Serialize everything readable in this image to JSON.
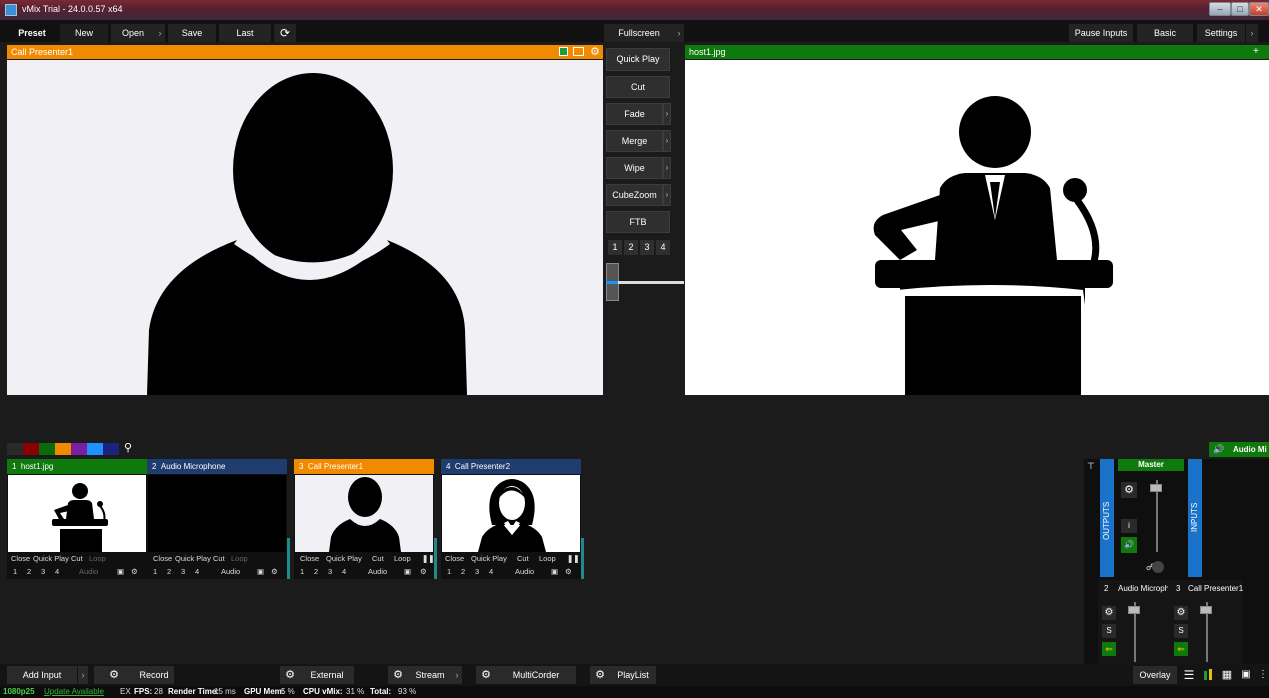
{
  "window": {
    "title": "vMix Trial - 24.0.0.57 x64"
  },
  "toolbar": {
    "preset": "Preset",
    "new": "New",
    "open": "Open",
    "save": "Save",
    "last": "Last",
    "fullscreen": "Fullscreen",
    "pause_inputs": "Pause Inputs",
    "basic": "Basic",
    "settings": "Settings"
  },
  "preview": {
    "title": "Call Presenter1",
    "accent": "#f28a00"
  },
  "output": {
    "title": "host1.jpg",
    "accent": "#0e7a0e"
  },
  "transitions": {
    "quick_play": "Quick Play",
    "cut": "Cut",
    "fade": "Fade",
    "merge": "Merge",
    "wipe": "Wipe",
    "cubezoom": "CubeZoom",
    "ftb": "FTB",
    "numbers": [
      "1",
      "2",
      "3",
      "4"
    ]
  },
  "colors": {
    "swatches": [
      "#8b0000",
      "#0a6b0a",
      "#f28a00",
      "#7a1fa2",
      "#1e90ff",
      "#1a237e"
    ],
    "preview_orange": "#f28a00",
    "program_green": "#0e7a0e",
    "input_blue": "#1e3d6e",
    "mixer_blue": "#1a73c9"
  },
  "inputs": [
    {
      "number": "1",
      "name": "host1.jpg",
      "header_color": "#0e7a0e"
    },
    {
      "number": "2",
      "name": "Audio Microphone",
      "header_color": "#1e3d6e"
    },
    {
      "number": "3",
      "name": "Call Presenter1",
      "header_color": "#f28a00"
    },
    {
      "number": "4",
      "name": "Call Presenter2",
      "header_color": "#1e3d6e"
    }
  ],
  "card_controls": {
    "close": "Close",
    "quick_play": "Quick Play",
    "cut": "Cut",
    "loop": "Loop",
    "audio": "Audio",
    "nums": [
      "1",
      "2",
      "3",
      "4"
    ]
  },
  "audio": {
    "header": "Audio Mi",
    "master": "Master",
    "outputs": "OUTPUTS",
    "inputs": "INPUTS",
    "i_label": "i",
    "channels": [
      {
        "number": "2",
        "name": "Audio Micropho"
      },
      {
        "number": "3",
        "name": "Call Presenter1"
      }
    ],
    "solo": "S"
  },
  "bottombar": {
    "add_input": "Add Input",
    "record": "Record",
    "external": "External",
    "stream": "Stream",
    "multicorder": "MultiCorder",
    "playlist": "PlayList",
    "overlay": "Overlay"
  },
  "status": {
    "format": "1080p25",
    "update": "Update Available",
    "ex": "EX",
    "fps_label": "FPS:",
    "fps": "28",
    "render_label": "Render Time:",
    "render": "15 ms",
    "gpu_label": "GPU Mem:",
    "gpu": "5 %",
    "cpu_label": "CPU vMix:",
    "cpu": "31 %",
    "total_label": "Total:",
    "total": "93 %"
  }
}
